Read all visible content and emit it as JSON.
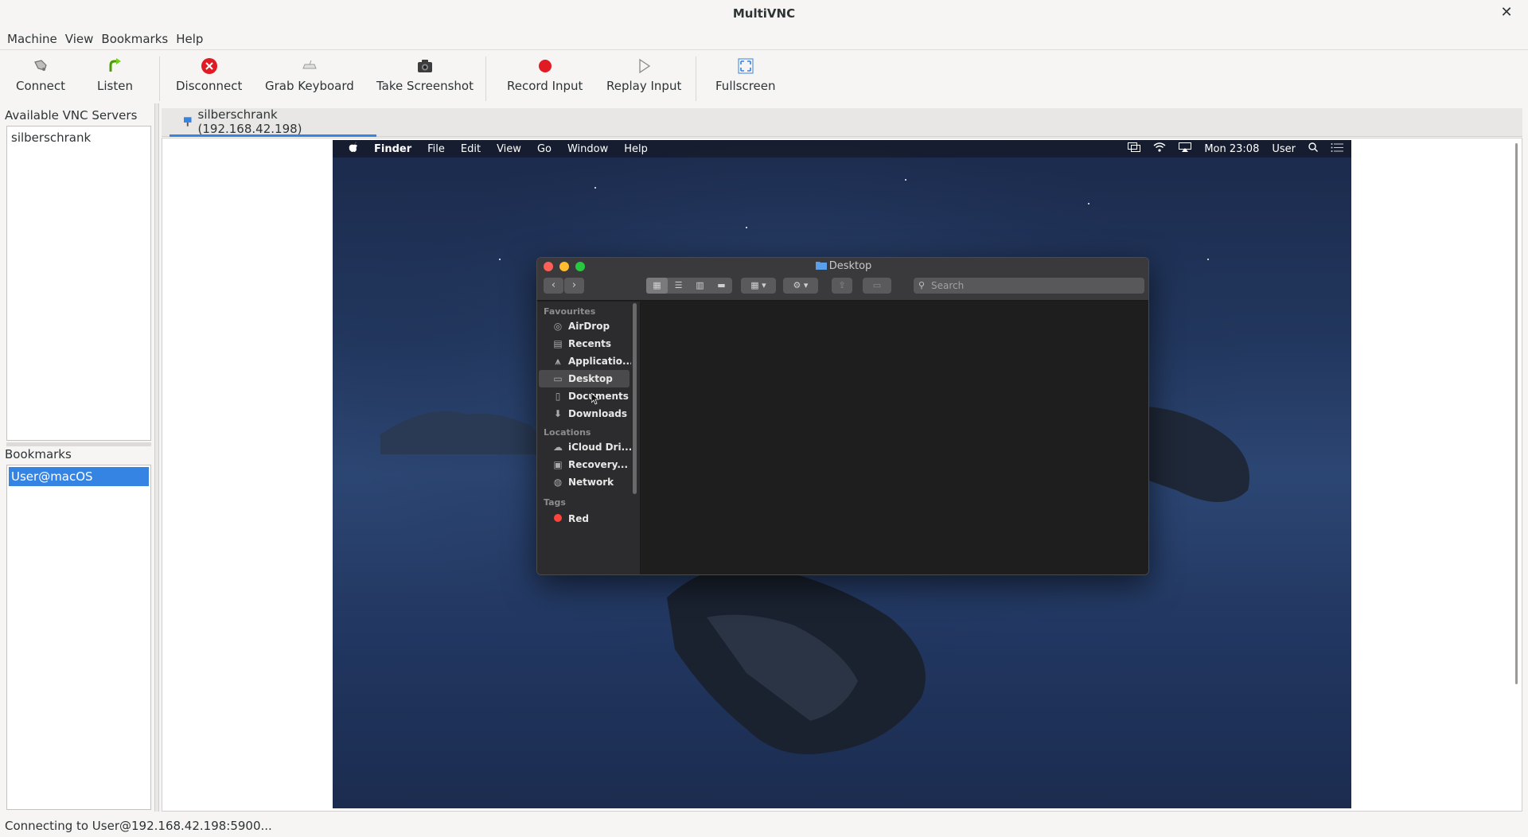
{
  "window": {
    "title": "MultiVNC",
    "close_glyph": "✕"
  },
  "menubar": {
    "items": [
      "Machine",
      "View",
      "Bookmarks",
      "Help"
    ]
  },
  "toolbar": {
    "connect": "Connect",
    "listen": "Listen",
    "disconnect": "Disconnect",
    "grab_keyboard": "Grab Keyboard",
    "take_screenshot": "Take Screenshot",
    "record_input": "Record Input",
    "replay_input": "Replay Input",
    "fullscreen": "Fullscreen"
  },
  "servers": {
    "label": "Available VNC Servers",
    "items": [
      "silberschrank"
    ]
  },
  "bookmarks": {
    "label": "Bookmarks",
    "items": [
      "User@macOS"
    ]
  },
  "tab": {
    "label": "silberschrank (192.168.42.198)"
  },
  "remote": {
    "menubar": {
      "apple": "",
      "app": "Finder",
      "items": [
        "File",
        "Edit",
        "View",
        "Go",
        "Window",
        "Help"
      ],
      "clock": "Mon 23:08",
      "user": "User"
    },
    "finder": {
      "title": "Desktop",
      "search_placeholder": "Search",
      "favourites_label": "Favourites",
      "favourites": [
        "AirDrop",
        "Recents",
        "Applicatio...",
        "Desktop",
        "Documents",
        "Downloads"
      ],
      "locations_label": "Locations",
      "locations": [
        "iCloud Dri...",
        "Recovery...",
        "Network"
      ],
      "tags_label": "Tags",
      "tags": [
        "Red"
      ],
      "selected_item": "Desktop"
    }
  },
  "status": {
    "text": "Connecting to User@192.168.42.198:5900..."
  },
  "colors": {
    "selection": "#3584e4",
    "tab_underline": "#3584e4",
    "disconnect_red": "#e01b24"
  }
}
